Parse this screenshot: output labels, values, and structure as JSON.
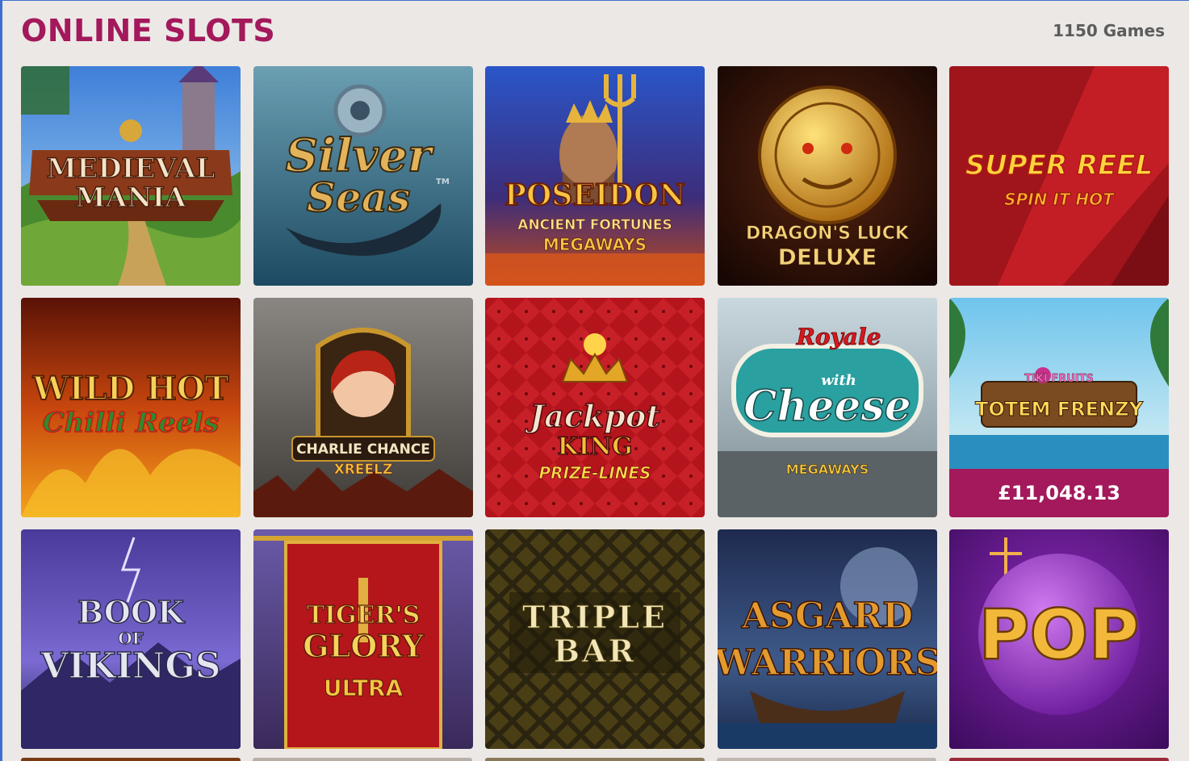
{
  "header": {
    "title": "ONLINE SLOTS",
    "count": "1150 Games"
  },
  "games": [
    {
      "name": "medieval-mania",
      "lines": [
        "MEDIEVAL",
        "MANIA"
      ]
    },
    {
      "name": "silver-seas",
      "lines": [
        "Silver",
        "Seas"
      ],
      "tm": "TM"
    },
    {
      "name": "poseidon",
      "lines": [
        "POSEIDON",
        "ANCIENT FORTUNES",
        "MEGAWAYS"
      ]
    },
    {
      "name": "dragons-luck-deluxe",
      "lines": [
        "DRAGON'S LUCK",
        "DELUXE"
      ]
    },
    {
      "name": "super-reel",
      "lines": [
        "SUPER REEL",
        "SPIN IT HOT"
      ]
    },
    {
      "name": "wild-hot-chilli-reels",
      "lines": [
        "WILD HOT",
        "Chilli Reels"
      ]
    },
    {
      "name": "charlie-chance",
      "lines": [
        "CHARLIE CHANCE",
        "XREELZ"
      ]
    },
    {
      "name": "jackpot-king",
      "lines": [
        "Jackpot",
        "KING",
        "PRIZE-LINES"
      ]
    },
    {
      "name": "royale-with-cheese",
      "lines": [
        "Royale",
        "with",
        "Cheese",
        "MEGAWAYS"
      ]
    },
    {
      "name": "totem-frenzy",
      "lines": [
        "TIKI FRUITS",
        "TOTEM FRENZY"
      ],
      "jackpot": "£11,048.13"
    },
    {
      "name": "book-of-vikings",
      "lines": [
        "BOOK",
        "OF",
        "VIKINGS"
      ]
    },
    {
      "name": "tigers-glory",
      "lines": [
        "TIGER'S",
        "GLORY",
        "ULTRA"
      ]
    },
    {
      "name": "triple-bar",
      "lines": [
        "TRIPLE",
        "BAR"
      ]
    },
    {
      "name": "asgard-warriors",
      "lines": [
        "ASGARD",
        "WARRIORS"
      ]
    },
    {
      "name": "pop",
      "lines": [
        "POP"
      ]
    }
  ],
  "colors": {
    "accent": "#a3195b",
    "background": "#ece8e6"
  }
}
